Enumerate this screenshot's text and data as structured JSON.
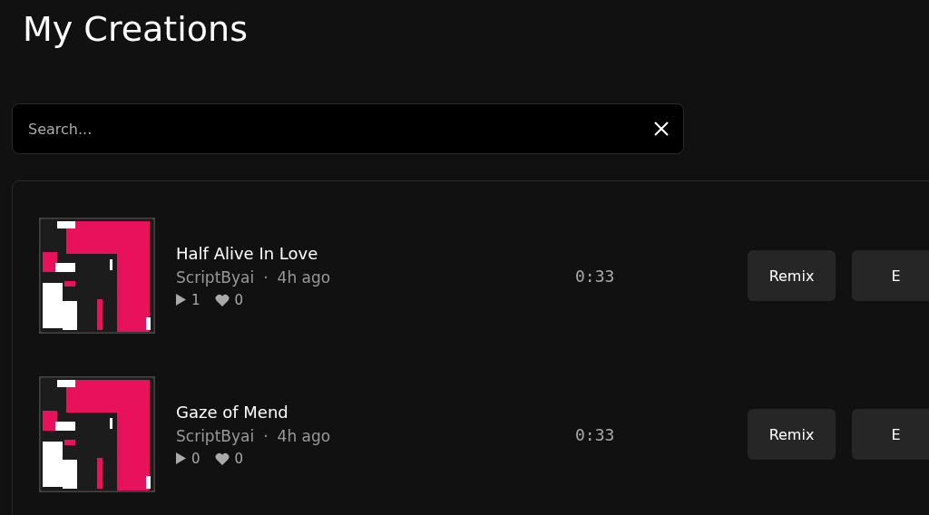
{
  "page": {
    "title": "My Creations"
  },
  "search": {
    "placeholder": "Search..."
  },
  "songs": [
    {
      "title": "Half Alive In Love",
      "author": "ScriptByai",
      "separator": "·",
      "age": "4h ago",
      "plays": "1",
      "likes": "0",
      "duration": "0:33",
      "buttons": [
        "Remix",
        "E"
      ]
    },
    {
      "title": "Gaze of Mend",
      "author": "ScriptByai",
      "separator": "·",
      "age": "4h ago",
      "plays": "0",
      "likes": "0",
      "duration": "0:33",
      "buttons": [
        "Remix",
        "E"
      ]
    }
  ]
}
